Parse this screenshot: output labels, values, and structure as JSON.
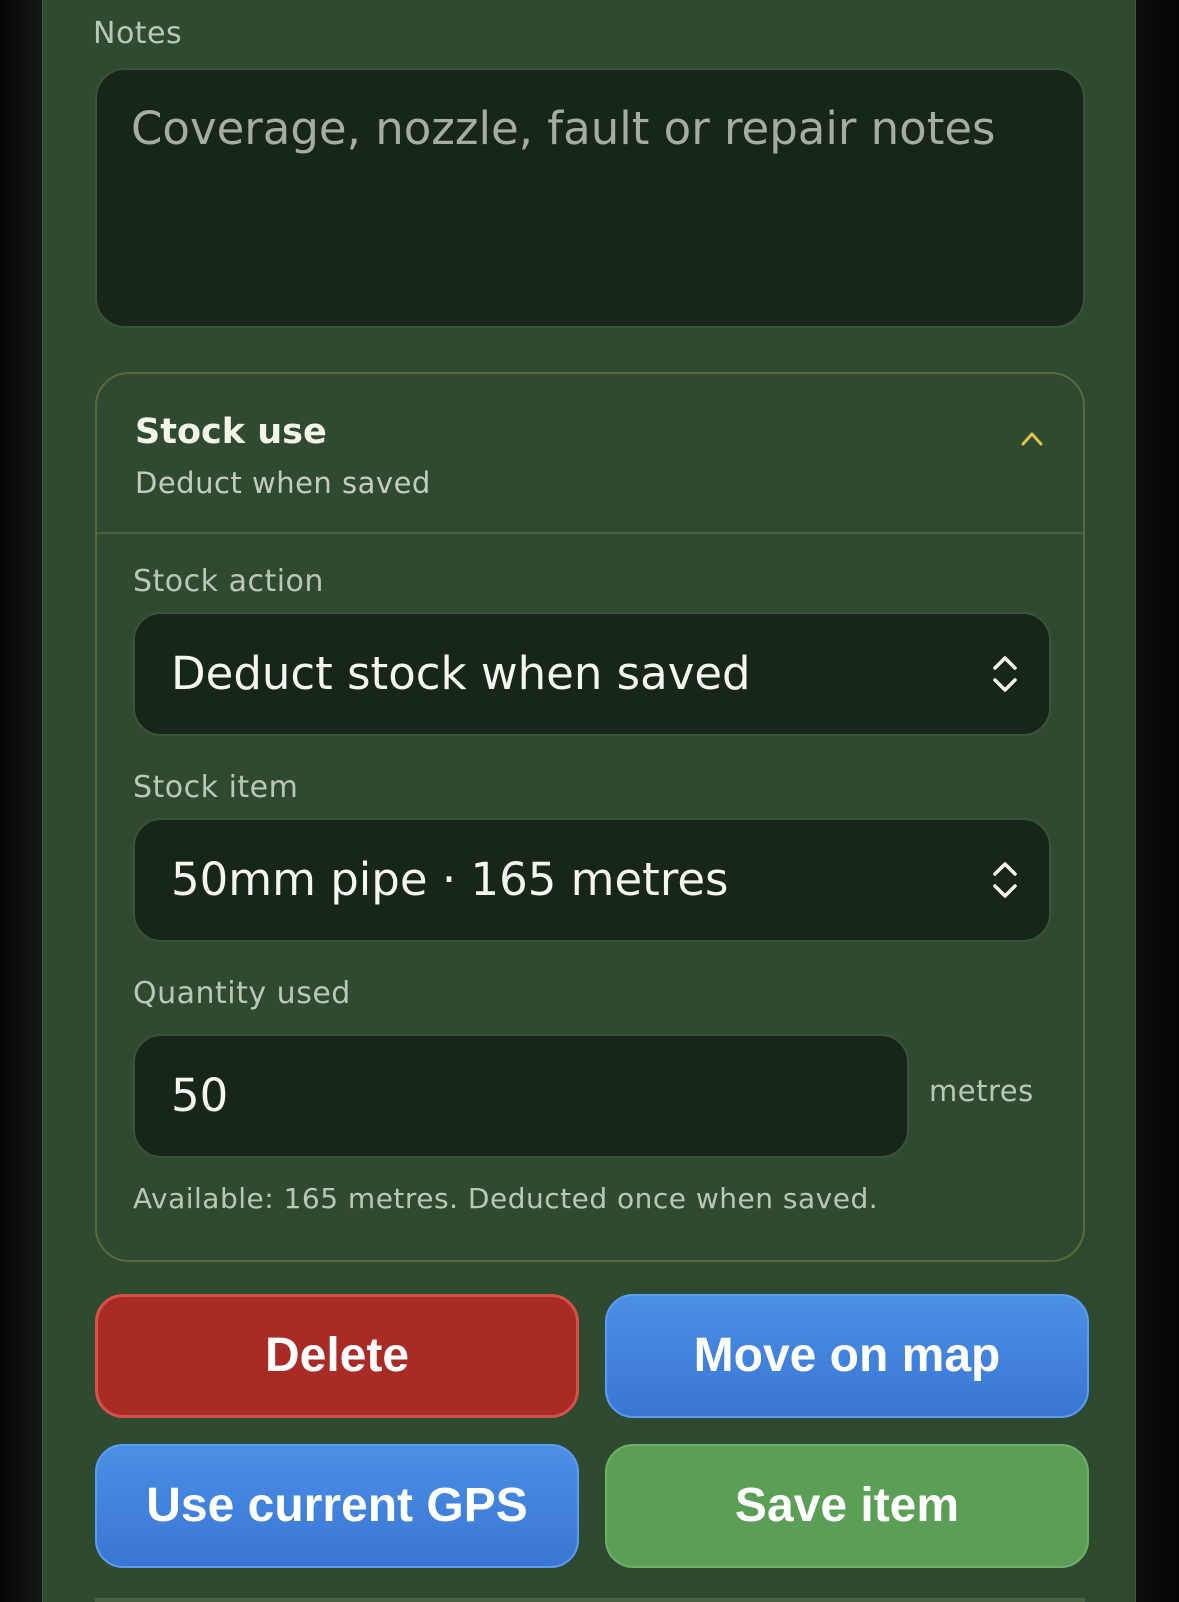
{
  "notes": {
    "label": "Notes",
    "placeholder": "Coverage, nozzle, fault or repair notes"
  },
  "stock_use": {
    "title": "Stock use",
    "subtitle": "Deduct when saved",
    "stock_action": {
      "label": "Stock action",
      "value": "Deduct stock when saved"
    },
    "stock_item": {
      "label": "Stock item",
      "value": "50mm pipe · 165 metres"
    },
    "quantity": {
      "label": "Quantity used",
      "value": "50",
      "unit": "metres"
    },
    "hint": "Available: 165 metres. Deducted once when saved."
  },
  "actions": {
    "delete_label": "Delete",
    "move_label": "Move on map",
    "gps_label": "Use current GPS",
    "save_label": "Save item"
  },
  "colors": {
    "panel": "#2e4a30",
    "field": "#18261a",
    "accent_chevron": "#e0c24a",
    "delete": "#a92b26",
    "blue": "#4a8fe6",
    "save": "#5b9e55"
  },
  "icons": {
    "collapse": "chevron-up-icon",
    "select": "select-arrows-icon"
  }
}
